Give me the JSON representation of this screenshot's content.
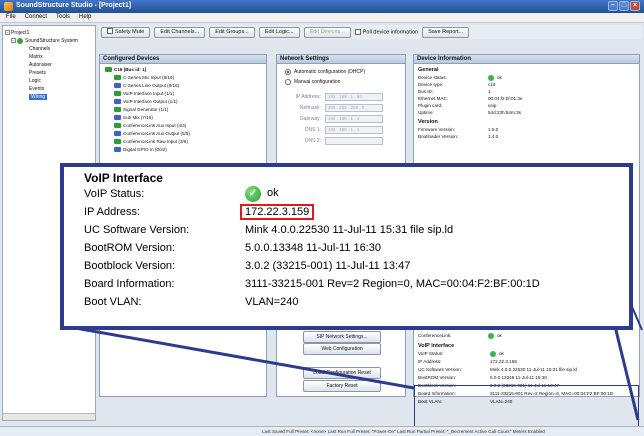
{
  "window": {
    "title": "SoundStructure Studio - [Project1]"
  },
  "menu": [
    "File",
    "Connect",
    "Tools",
    "Help"
  ],
  "tree": {
    "items": [
      {
        "label": "Project1",
        "indent": 0
      },
      {
        "label": "SoundStructure System",
        "indent": 1
      },
      {
        "label": "Channels",
        "indent": 2
      },
      {
        "label": "Matrix",
        "indent": 2
      },
      {
        "label": "Autoraiser",
        "indent": 2
      },
      {
        "label": "Presets",
        "indent": 2
      },
      {
        "label": "Logic",
        "indent": 2
      },
      {
        "label": "Events",
        "indent": 2
      },
      {
        "label": "Wiring",
        "indent": 2,
        "selected": true
      }
    ]
  },
  "toolbar": {
    "safety_mute": "Safety Mute",
    "edit_channels": "Edit Channels...",
    "edit_groups": "Edit Groups...",
    "edit_logic": "Edit Logic...",
    "edit_devices": "Edit Devices...",
    "poll_device_info": "Poll device information",
    "save_report": "Save Report..."
  },
  "configured_devices": {
    "title": "Configured Devices",
    "items": [
      "C16 [Bus id: 1]",
      "C-Series Mic Input (8/16)",
      "C-Series Line Output (8/16)",
      "VoIP Interface Input (1/1)",
      "VoIP Interface Output (1/1)",
      "Signal Generator (1/1)",
      "Sub Mix (7/16)",
      "ConferenceLink Aux Input (4/4)",
      "ConferenceLink Aux Output (5/5)",
      "ConferenceLink Raw Input (3/6)",
      "Digital GPIO In (0/22)"
    ]
  },
  "network_settings": {
    "title": "Network Settings",
    "auto_dhcp": "Automatic configuration (DHCP)",
    "manual": "Manual configuration",
    "fields": [
      {
        "label": "IP Address:",
        "value": "192 . 168 . 1 . 50"
      },
      {
        "label": "Netmask:",
        "value": "255 . 255 . 255 . 0"
      },
      {
        "label": "Gateway:",
        "value": "192 . 168 . 1 . 1"
      },
      {
        "label": "DNS 1:",
        "value": "192 . 168 . 1 . 1"
      },
      {
        "label": "DNS 2:",
        "value": ""
      }
    ],
    "sip_settings": "SIP Network Settings...",
    "web_configuration": "Web Configuration",
    "local_config_reset": "Local Configuration Reset",
    "factory_reset": "Factory Reset"
  },
  "device_information": {
    "title": "Device Information",
    "general": {
      "heading": "General",
      "rows": [
        {
          "k": "Device status:",
          "v": "ok",
          "ok": true
        },
        {
          "k": "Device type:",
          "v": "c16"
        },
        {
          "k": "Bus ID:",
          "v": "1"
        },
        {
          "k": "Ethernet MAC:",
          "v": "00:04:f2:bf:01:3e"
        },
        {
          "k": "Plugin card:",
          "v": "voip"
        },
        {
          "k": "Uptime:",
          "v": "54d:23h:54m:3s"
        }
      ]
    },
    "version": {
      "heading": "Version",
      "rows": [
        {
          "k": "Firmware Version:",
          "v": "1.5.0"
        },
        {
          "k": "Bootloader Version:",
          "v": "1.4.0"
        }
      ]
    },
    "conferencelink_label": "ConferenceLink:",
    "conferencelink_value": "ok",
    "voip_small": {
      "heading": "VoIP Interface",
      "rows": [
        {
          "k": "VoIP Status:",
          "v": "ok",
          "ok": true
        },
        {
          "k": "IP Address:",
          "v": "172.22.3.159"
        },
        {
          "k": "UC Software Version:",
          "v": "Mink 4.0.0.22530 11-Jul-11 15:31 file sip.ld"
        },
        {
          "k": "BootROM Version:",
          "v": "5.0.0.13348 11-Jul-11 16:30"
        },
        {
          "k": "Bootblock Version:",
          "v": "3.0.2 (33215-001) 11-Jul-11 13:47"
        },
        {
          "k": "Board Information:",
          "v": "3111-33215-001 Rev=2 Region=0, MAC=00:04:F2:BF:00:1D"
        },
        {
          "k": "Boot VLAN:",
          "v": "VLAN=240"
        }
      ]
    }
  },
  "callout": {
    "title": "VoIP Interface",
    "rows": [
      {
        "k": "VoIP Status:",
        "v": "ok",
        "ok": true
      },
      {
        "k": "IP Address:",
        "v": "172.22.3.159",
        "highlight": true
      },
      {
        "k": "UC Software Version:",
        "v": "Mink 4.0.0.22530 11-Jul-11 15:31 file sip.ld"
      },
      {
        "k": "BootROM Version:",
        "v": "5.0.0.13348 11-Jul-11 16:30"
      },
      {
        "k": "Bootblock Version:",
        "v": "3.0.2 (33215-001) 11-Jul-11 13:47"
      },
      {
        "k": "Board Information:",
        "v": "3111-33215-001 Rev=2 Region=0, MAC=00:04:F2:BF:00:1D"
      },
      {
        "k": "Boot VLAN:",
        "v": "VLAN=240"
      }
    ]
  },
  "statusbar": {
    "text": "Last Saved Full Preset: <none>   Last Run Full Preset: \"Power-On\"   Last Run Partial Preset: \"_Decrement Active Call Count\"   Meters Enabled"
  },
  "colors": {
    "callout_border": "#2d3b8c",
    "highlight_box": "#e1191b",
    "title_bar": "#23508f"
  }
}
